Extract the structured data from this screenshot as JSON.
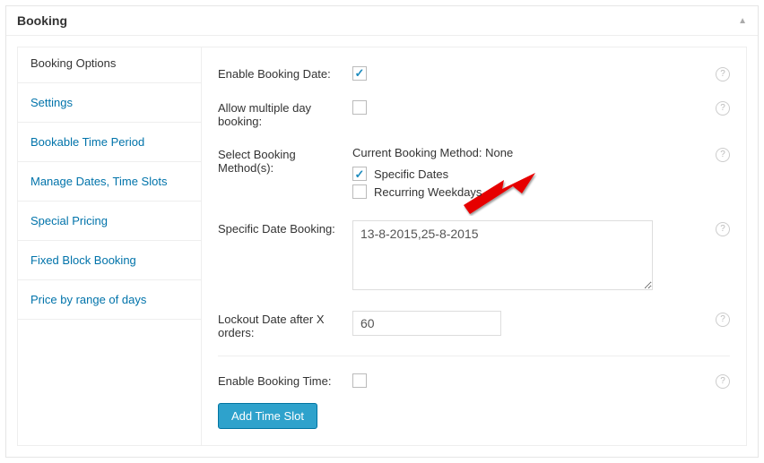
{
  "panel": {
    "title": "Booking"
  },
  "sidebar": {
    "title": "Booking Options",
    "items": [
      {
        "label": "Settings"
      },
      {
        "label": "Bookable Time Period"
      },
      {
        "label": "Manage Dates, Time Slots"
      },
      {
        "label": "Special Pricing"
      },
      {
        "label": "Fixed Block Booking"
      },
      {
        "label": "Price by range of days"
      }
    ]
  },
  "form": {
    "enable_booking_date_label": "Enable Booking Date:",
    "enable_booking_date_checked": true,
    "allow_multiple_day_label": "Allow multiple day booking:",
    "allow_multiple_day_checked": false,
    "select_method_label": "Select Booking Method(s):",
    "current_method_text": "Current Booking Method: None",
    "specific_dates_label": "Specific Dates",
    "specific_dates_checked": true,
    "recurring_weekdays_label": "Recurring Weekdays",
    "recurring_weekdays_checked": false,
    "specific_date_booking_label": "Specific Date Booking:",
    "specific_date_booking_value": "13-8-2015,25-8-2015",
    "lockout_label": "Lockout Date after X orders:",
    "lockout_value": "60",
    "enable_booking_time_label": "Enable Booking Time:",
    "enable_booking_time_checked": false,
    "add_time_slot_label": "Add Time Slot"
  }
}
